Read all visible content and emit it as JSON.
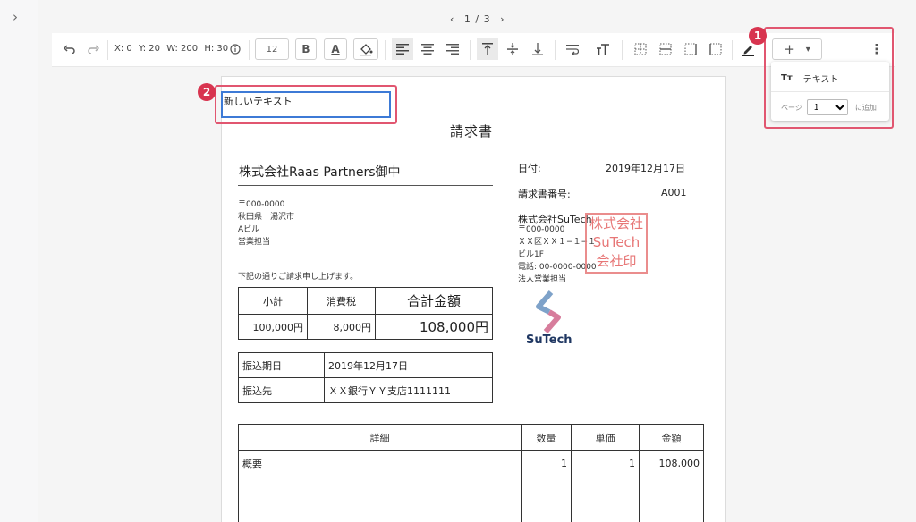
{
  "pager": {
    "prev": "‹",
    "label": "1 / 3",
    "next": "›"
  },
  "toolbar": {
    "x": "X: 0",
    "y": "Y: 20",
    "w": "W: 200",
    "h": "H: 30",
    "font_size": "12",
    "bold": "B",
    "font_color": "A",
    "add": "+",
    "add_dropdown": "▾",
    "more": "⋮"
  },
  "badges": {
    "one": "1",
    "two": "2"
  },
  "new_text": "新しいテキスト",
  "popup": {
    "item_label": "テキスト",
    "page_label": "ページ",
    "page_value": "1",
    "add_label": "に追加"
  },
  "invoice": {
    "title": "請求書",
    "client": "株式会社Raas Partners御中",
    "client_addr": [
      "〒000-0000",
      "秋田県　湯沢市",
      "Aビル",
      "営業担当"
    ],
    "note": "下記の通りご請求申し上げます。",
    "date_label": "日付:",
    "date_value": "2019年12月17日",
    "number_label": "請求書番号:",
    "number_value": "A001",
    "issuer_name": "株式会社SuTech",
    "issuer_addr": [
      "〒000-0000",
      "ＸＸ区ＸＸ１−１−１",
      "ビル1F",
      "電話: 00-0000-0000",
      "法人営業担当"
    ],
    "stamp_lines": [
      "株式会社",
      "SuTech",
      "会社印"
    ],
    "logo_text": "SuTech",
    "summary_headers": [
      "小計",
      "消費税",
      "合計金額"
    ],
    "summary_values": [
      "100,000円",
      "8,000円",
      "108,000円"
    ],
    "transfer": [
      {
        "label": "振込期日",
        "value": "2019年12月17日"
      },
      {
        "label": "振込先",
        "value": "ＸＸ銀行ＹＹ支店1111111"
      }
    ],
    "detail_headers": [
      "詳細",
      "数量",
      "単価",
      "金額"
    ],
    "detail_rows": [
      [
        "概要",
        "1",
        "1",
        "108,000"
      ],
      [
        "",
        "",
        "",
        ""
      ],
      [
        "",
        "",
        "",
        ""
      ]
    ]
  },
  "colors": {
    "highlight": "#e15670",
    "badge": "#d8344f",
    "selection": "#3d7ad6",
    "stamp": "#e35f5f"
  }
}
